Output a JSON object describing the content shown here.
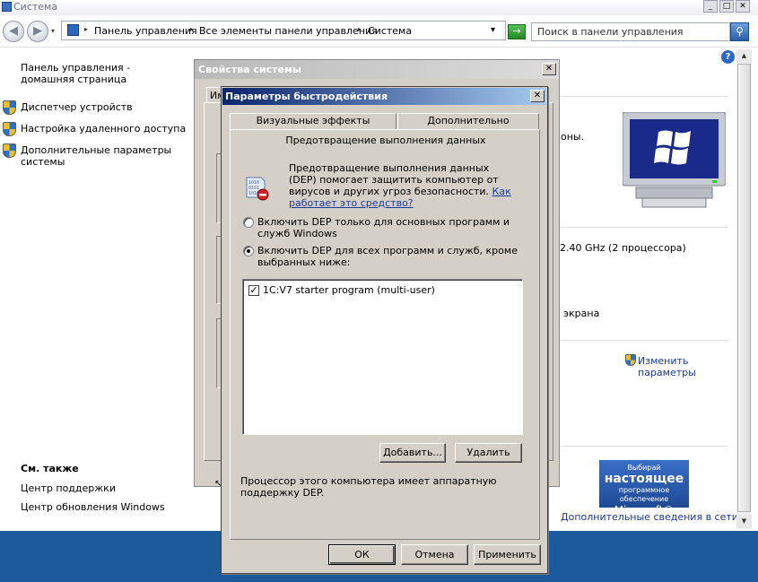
{
  "window": {
    "title": "Система"
  },
  "titlebar_buttons": [
    "_",
    "□",
    "✕"
  ],
  "nav": {
    "back_glyph": "◀",
    "forward_glyph": "▶",
    "breadcrumbs": [
      "Панель управления",
      "Все элементы панели управления",
      "Система"
    ],
    "crumb_arrow": "▸",
    "dropdown_glyph": "▾",
    "go_glyph": "→",
    "search_placeholder": "Поиск в панели управления",
    "search_glyph": "⚲"
  },
  "sidebar": {
    "home": "Панель управления - домашняя страница",
    "links": [
      "Диспетчер устройств",
      "Настройка удаленного доступа",
      "Дополнительные параметры системы"
    ]
  },
  "see_also": {
    "title": "См. также",
    "links": [
      "Центр поддержки",
      "Центр обновления Windows"
    ]
  },
  "help_glyph": "?",
  "main_text": {
    "frag_1": "оны.",
    "frag_2": "2.40 GHz  (2 процессора)",
    "frag_3": "экрана",
    "change_params": "Изменить параметры",
    "more_info": "Дополнительные сведения в сети...",
    "cursor_glyph": "↖"
  },
  "ms_badge": {
    "line1": "Выбирай",
    "line2": "настоящее",
    "line3": "программное обеспечение",
    "line4": "Microsoft®"
  },
  "scrollbar": {
    "up": "▲",
    "down": "▼"
  },
  "sysprops": {
    "title": "Свойства системы",
    "close": "✕",
    "tab": "Им"
  },
  "perf": {
    "title": "Параметры быстродействия",
    "close": "✕",
    "tabs": [
      "Визуальные эффекты",
      "Дополнительно"
    ],
    "dep_header": "Предотвращение выполнения данных",
    "dep_desc": "Предотвращение выполнения данных (DEP) помогает защитить компьютер от вирусов и других угроз безопасности.",
    "dep_link": "Как работает это средство?",
    "radio_1": "Включить DEP только для основных программ и служб Windows",
    "radio_2": "Включить DEP для всех программ и служб, кроме выбранных ниже:",
    "programs": [
      {
        "checked": true,
        "check_glyph": "✓",
        "name": "1C:V7 starter program (multi-user)"
      }
    ],
    "add_button": "Добавить...",
    "remove_button": "Удалить",
    "hw_note": "Процессор этого компьютера имеет аппаратную поддержку DEP.",
    "ok": "ОК",
    "cancel": "Отмена",
    "apply": "Применить"
  }
}
